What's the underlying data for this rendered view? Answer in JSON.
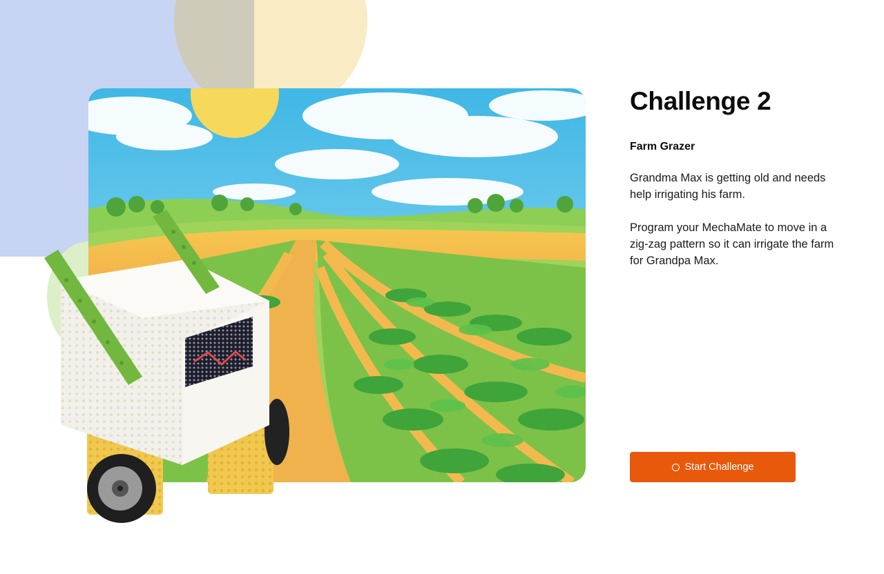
{
  "colors": {
    "accent": "#e8590c",
    "bg_block": "#c7d4f4",
    "bg_circle": "#f9ebc3",
    "bg_circle_overlap": "#cecbbb",
    "green_blob": "#dcefc9"
  },
  "challenge": {
    "title": "Challenge 2",
    "name": "Farm Grazer",
    "paragraphs": [
      "Grandma Max is getting old and needs help irrigating his farm.",
      "Program your MechaMate to move in a zig-zag pattern so it can irrigate the farm for Grandpa Max."
    ]
  },
  "actions": {
    "start_label": "Start Challenge",
    "start_icon": "circle-icon"
  }
}
